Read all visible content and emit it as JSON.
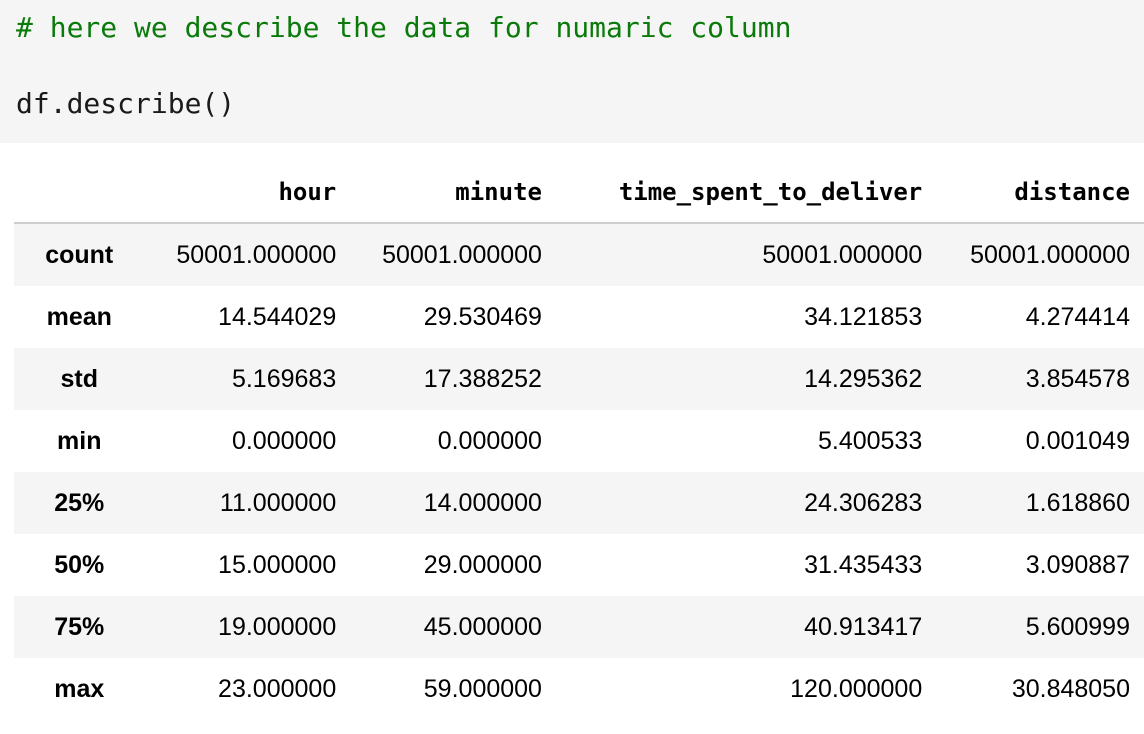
{
  "code": {
    "comment": "# here we describe the data for numaric column",
    "call": "df.describe()"
  },
  "table": {
    "columns": [
      "hour",
      "minute",
      "time_spent_to_deliver",
      "distance"
    ],
    "rows": [
      {
        "label": "count",
        "values": [
          "50001.000000",
          "50001.000000",
          "50001.000000",
          "50001.000000"
        ]
      },
      {
        "label": "mean",
        "values": [
          "14.544029",
          "29.530469",
          "34.121853",
          "4.274414"
        ]
      },
      {
        "label": "std",
        "values": [
          "5.169683",
          "17.388252",
          "14.295362",
          "3.854578"
        ]
      },
      {
        "label": "min",
        "values": [
          "0.000000",
          "0.000000",
          "5.400533",
          "0.001049"
        ]
      },
      {
        "label": "25%",
        "values": [
          "11.000000",
          "14.000000",
          "24.306283",
          "1.618860"
        ]
      },
      {
        "label": "50%",
        "values": [
          "15.000000",
          "29.000000",
          "31.435433",
          "3.090887"
        ]
      },
      {
        "label": "75%",
        "values": [
          "19.000000",
          "45.000000",
          "40.913417",
          "5.600999"
        ]
      },
      {
        "label": "max",
        "values": [
          "23.000000",
          "59.000000",
          "120.000000",
          "30.848050"
        ]
      }
    ]
  }
}
